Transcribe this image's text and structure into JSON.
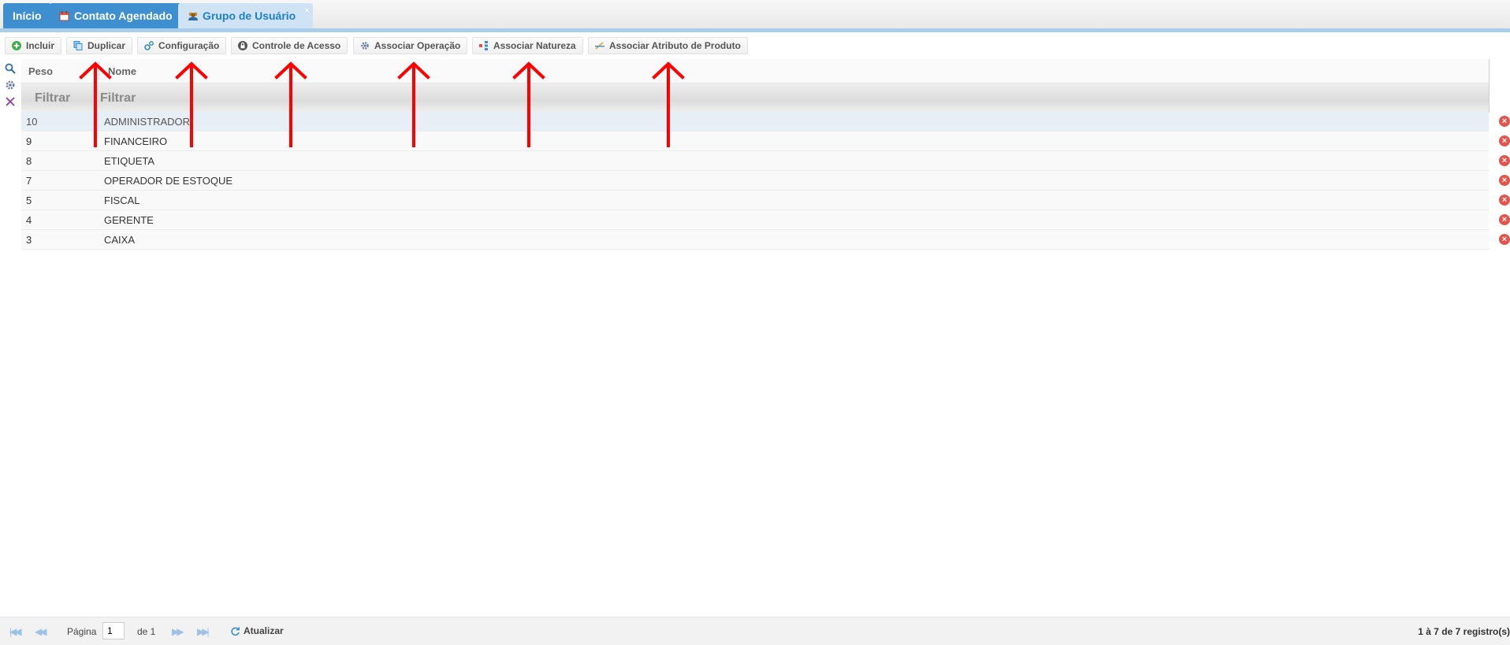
{
  "tabs": [
    {
      "label": "Início",
      "icon": "home-icon"
    },
    {
      "label": "Contato Agendado",
      "icon": "calendar-icon"
    },
    {
      "label": "Grupo de Usuário",
      "icon": "users-group-icon",
      "active": true,
      "close": "×"
    }
  ],
  "toolbar": {
    "incluir": "Incluir",
    "duplicar": "Duplicar",
    "configuracao": "Configuração",
    "controle_acesso": "Controle de Acesso",
    "associar_operacao": "Associar Operação",
    "associar_natureza": "Associar Natureza",
    "associar_atributo": "Associar Atributo de Produto"
  },
  "side_tools": [
    "search-icon",
    "gear-icon",
    "clear-filter-icon"
  ],
  "grid": {
    "columns": [
      "Peso",
      "Nome"
    ],
    "filters": [
      "Filtrar",
      "Filtrar"
    ],
    "rows": [
      {
        "peso": "10",
        "nome": "ADMINISTRADOR"
      },
      {
        "peso": "9",
        "nome": "FINANCEIRO"
      },
      {
        "peso": "8",
        "nome": "ETIQUETA"
      },
      {
        "peso": "7",
        "nome": "OPERADOR DE ESTOQUE"
      },
      {
        "peso": "5",
        "nome": "FISCAL"
      },
      {
        "peso": "4",
        "nome": "GERENTE"
      },
      {
        "peso": "3",
        "nome": "CAIXA"
      }
    ],
    "delete_symbol": "×"
  },
  "footer": {
    "page_label": "Página",
    "page_value": "1",
    "of_label": "de 1",
    "refresh_label": "Atualizar",
    "count": "1 à 7 de 7 registro(s)"
  },
  "colors": {
    "tab_blue": "#3d8fd0",
    "tab_active_bg": "#cfe3f5",
    "accent_border": "#a9cdec",
    "delete_red": "#e4544d",
    "annotation_red": "#ff0000"
  }
}
